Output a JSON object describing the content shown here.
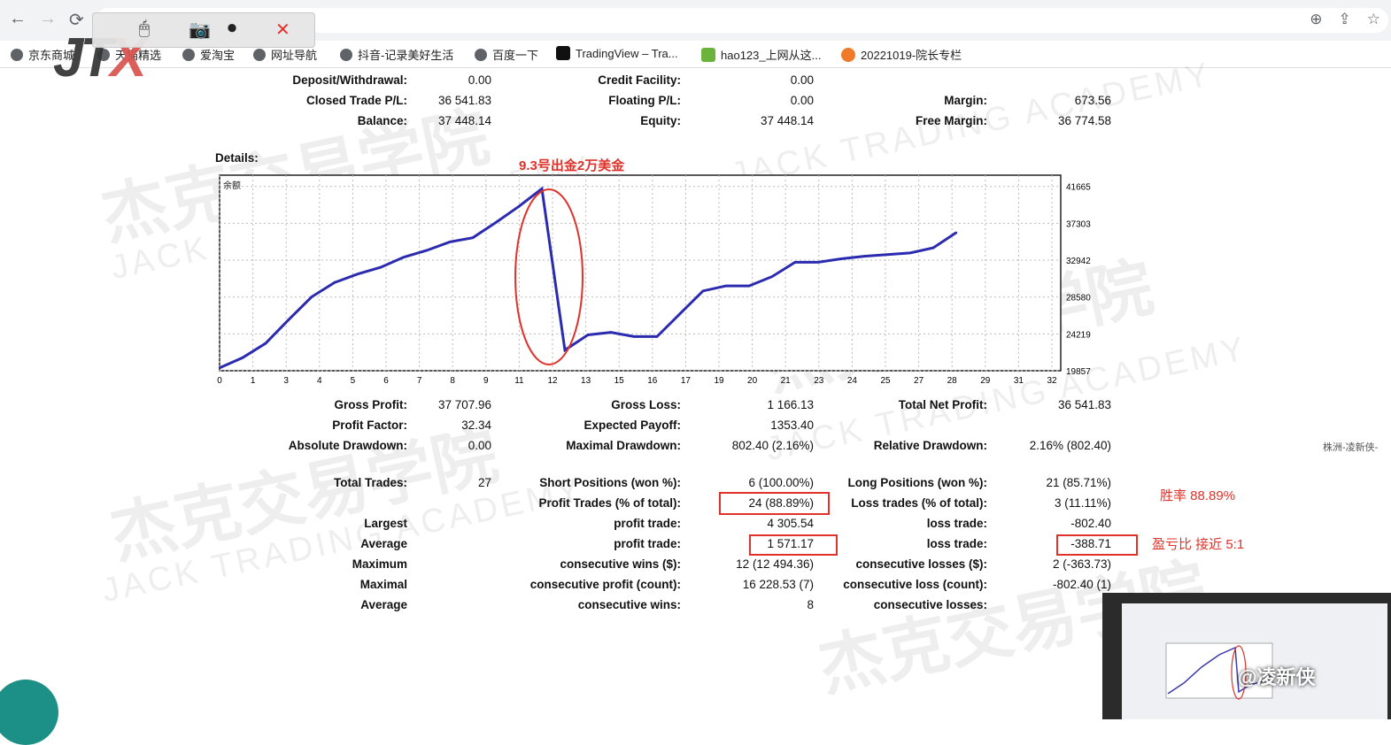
{
  "browser": {
    "nav": [
      "←",
      "→",
      "⟳"
    ],
    "url_icons": [
      "⊕",
      "⇪",
      "☆"
    ],
    "bookmarks": [
      "京东商城",
      "天猫精选",
      "爱淘宝",
      "网址导航",
      "抖音-记录美好生活",
      "百度一下",
      "TradingView – Tra...",
      "hao123_上网从这...",
      "20221019-院长专栏"
    ]
  },
  "toolbar_icons": [
    "mouse-icon",
    "camera-icon",
    "record-icon",
    "close-icon"
  ],
  "logo": {
    "text": "JT",
    "accent": "X"
  },
  "summary": {
    "deposit_label": "Deposit/Withdrawal:",
    "deposit": "0.00",
    "credit_label": "Credit Facility:",
    "credit": "0.00",
    "closed_label": "Closed Trade P/L:",
    "closed": "36 541.83",
    "floating_label": "Floating P/L:",
    "floating": "0.00",
    "margin_label": "Margin:",
    "margin": "673.56",
    "balance_label": "Balance:",
    "balance": "37 448.14",
    "equity_label": "Equity:",
    "equity": "37 448.14",
    "free_label": "Free Margin:",
    "free": "36 774.58"
  },
  "details_label": "Details:",
  "annotation_withdraw": "9.3号出金2万美金",
  "chart_data": {
    "type": "line",
    "title": "余额",
    "x": [
      0,
      1,
      2,
      3,
      4,
      5,
      6,
      7,
      8,
      9,
      10,
      11,
      12,
      13,
      14,
      15,
      16,
      17,
      18,
      19,
      20,
      21,
      22,
      23,
      24,
      25,
      26,
      27,
      28
    ],
    "x_tick_labels": [
      "0",
      "1",
      "3",
      "4",
      "5",
      "6",
      "7",
      "8",
      "9",
      "11",
      "12",
      "13",
      "15",
      "16",
      "17",
      "19",
      "20",
      "21",
      "23",
      "24",
      "25",
      "27",
      "28",
      "29",
      "31",
      "32"
    ],
    "y": [
      20200,
      21400,
      23100,
      25900,
      28600,
      30300,
      31300,
      32100,
      33300,
      34100,
      35100,
      35600,
      37400,
      39300,
      41400,
      22300,
      24100,
      24400,
      23900,
      23900,
      26600,
      29300,
      29900,
      29900,
      31000,
      32700,
      32700,
      33100,
      33400,
      33600,
      33800,
      34400,
      36200
    ],
    "yticks": [
      41665,
      37303,
      32942,
      28580,
      24219,
      19857
    ],
    "ylim": [
      19857,
      43000
    ],
    "color": "#2b2bb0"
  },
  "stats": {
    "gross_profit_label": "Gross Profit:",
    "gross_profit": "37 707.96",
    "gross_loss_label": "Gross Loss:",
    "gross_loss": "1 166.13",
    "net_profit_label": "Total Net Profit:",
    "net_profit": "36 541.83",
    "profit_factor_label": "Profit Factor:",
    "profit_factor": "32.34",
    "expected_label": "Expected Payoff:",
    "expected": "1353.40",
    "abs_dd_label": "Absolute Drawdown:",
    "abs_dd": "0.00",
    "max_dd_label": "Maximal Drawdown:",
    "max_dd": "802.40 (2.16%)",
    "rel_dd_label": "Relative Drawdown:",
    "rel_dd": "2.16% (802.40)",
    "total_trades_label": "Total Trades:",
    "total_trades": "27",
    "short_label": "Short Positions (won %):",
    "short": "6 (100.00%)",
    "long_label": "Long Positions (won %):",
    "long": "21 (85.71%)",
    "profit_trades_label": "Profit Trades (% of total):",
    "profit_trades": "24 (88.89%)",
    "loss_trades_label": "Loss trades (% of total):",
    "loss_trades": "3 (11.11%)",
    "largest_label": "Largest",
    "largest_profit_label": "profit trade:",
    "largest_profit": "4 305.54",
    "largest_loss_label": "loss trade:",
    "largest_loss": "-802.40",
    "average_label": "Average",
    "avg_profit_label": "profit trade:",
    "avg_profit": "1 571.17",
    "avg_loss_label": "loss trade:",
    "avg_loss": "-388.71",
    "maximum_label": "Maximum",
    "cons_wins_label": "consecutive wins ($):",
    "cons_wins": "12 (12 494.36)",
    "cons_losses_label": "consecutive losses ($):",
    "cons_losses": "2 (-363.73)",
    "maximal_label": "Maximal",
    "cons_profit_label": "consecutive profit (count):",
    "cons_profit": "16 228.53 (7)",
    "cons_loss_label": "consecutive loss (count):",
    "cons_loss": "-802.40 (1)",
    "average2_label": "Average",
    "avg_wins_label": "consecutive wins:",
    "avg_wins": "8",
    "avg_losses_label": "consecutive losses:"
  },
  "annotation_winrate": "胜率 88.89%",
  "annotation_ratio": "盈亏比 接近 5:1",
  "side_label": "株洲-凌新侠-",
  "video_tag": "@凌新侠",
  "watermarks": [
    "杰克交易学院",
    "JACK TRADING ACADEMY"
  ]
}
